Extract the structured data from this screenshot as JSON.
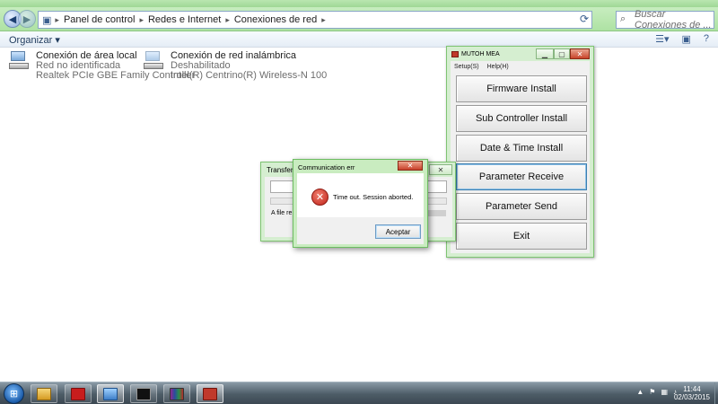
{
  "explorer": {
    "breadcrumbs": [
      "Panel de control",
      "Redes e Internet",
      "Conexiones de red"
    ],
    "search_placeholder": "Buscar Conexiones de ...",
    "organize_label": "Organizar"
  },
  "adapters": [
    {
      "name": "Conexión de área local",
      "status": "Red no identificada",
      "device": "Realtek PCIe GBE Family Controller"
    },
    {
      "name": "Conexión de red inalámbrica",
      "status": "Deshabilitado",
      "device": "Intel(R) Centrino(R) Wireless-N 100"
    }
  ],
  "mutoh": {
    "title": "MUTOH MEA",
    "menu": [
      "Setup(S)",
      "Help(H)"
    ],
    "buttons": [
      "Firmware Install",
      "Sub Controller Install",
      "Date & Time Install",
      "Parameter Receive",
      "Parameter Send",
      "Exit"
    ]
  },
  "transfer": {
    "title": "Transferi",
    "file_text": "A file re"
  },
  "error_dialog": {
    "title": "Communication err",
    "message": "Time out. Session aborted.",
    "ok_label": "Aceptar"
  },
  "taskbar": {
    "time": "11:44",
    "date": "02/03/2015",
    "pinned_icons": [
      "explorer-icon",
      "pdf-icon",
      "control-panel-icon",
      "console-icon",
      "winrar-icon",
      "pmc-app-icon"
    ]
  },
  "colors": {
    "window_frame": "#c9ecc0",
    "error_red": "#c0231a",
    "taskbar": "#4d5c67"
  }
}
